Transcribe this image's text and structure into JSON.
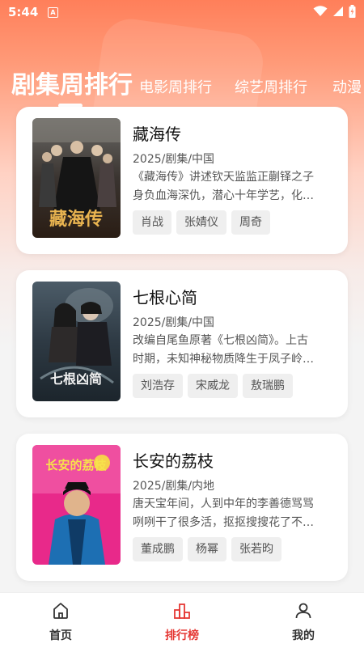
{
  "status": {
    "time": "5:44",
    "notif_letter": "A"
  },
  "tabs": [
    {
      "label": "剧集周排行",
      "active": true
    },
    {
      "label": "电影周排行",
      "active": false
    },
    {
      "label": "综艺周排行",
      "active": false
    },
    {
      "label": "动漫",
      "active": false
    }
  ],
  "cards": [
    {
      "title": "藏海传",
      "meta": "2025/剧集/中国",
      "desc1": "《藏海传》讲述钦天监监正蒯铎之子",
      "desc2": "身负血海深仇，潜心十年学艺，化…",
      "tags": [
        "肖战",
        "张婧仪",
        "周奇"
      ],
      "poster_text": "藏海传"
    },
    {
      "title": "七根心简",
      "meta": "2025/剧集/中国",
      "desc1": "改编自尾鱼原著《七根凶简》。上古",
      "desc2": "时期，未知神秘物质降生于凤子岭…",
      "tags": [
        "刘浩存",
        "宋威龙",
        "敖瑞鹏"
      ],
      "poster_text": "七根凶简"
    },
    {
      "title": "长安的荔枝",
      "meta": "2025/剧集/内地",
      "desc1": "唐天宝年间，人到中年的李善德骂骂",
      "desc2": "咧咧干了很多活，抠抠搜搜花了不…",
      "tags": [
        "董成鹏",
        "杨幂",
        "张若昀"
      ],
      "poster_text": "长安的荔枝"
    }
  ],
  "nav": [
    {
      "label": "首页",
      "icon": "home-icon",
      "active": false
    },
    {
      "label": "排行榜",
      "icon": "ranking-icon",
      "active": true
    },
    {
      "label": "我的",
      "icon": "user-icon",
      "active": false
    }
  ],
  "colors": {
    "accent": "#e53935",
    "header_gradient_top": "#ff7f5a",
    "background": "#f4f4f4"
  }
}
